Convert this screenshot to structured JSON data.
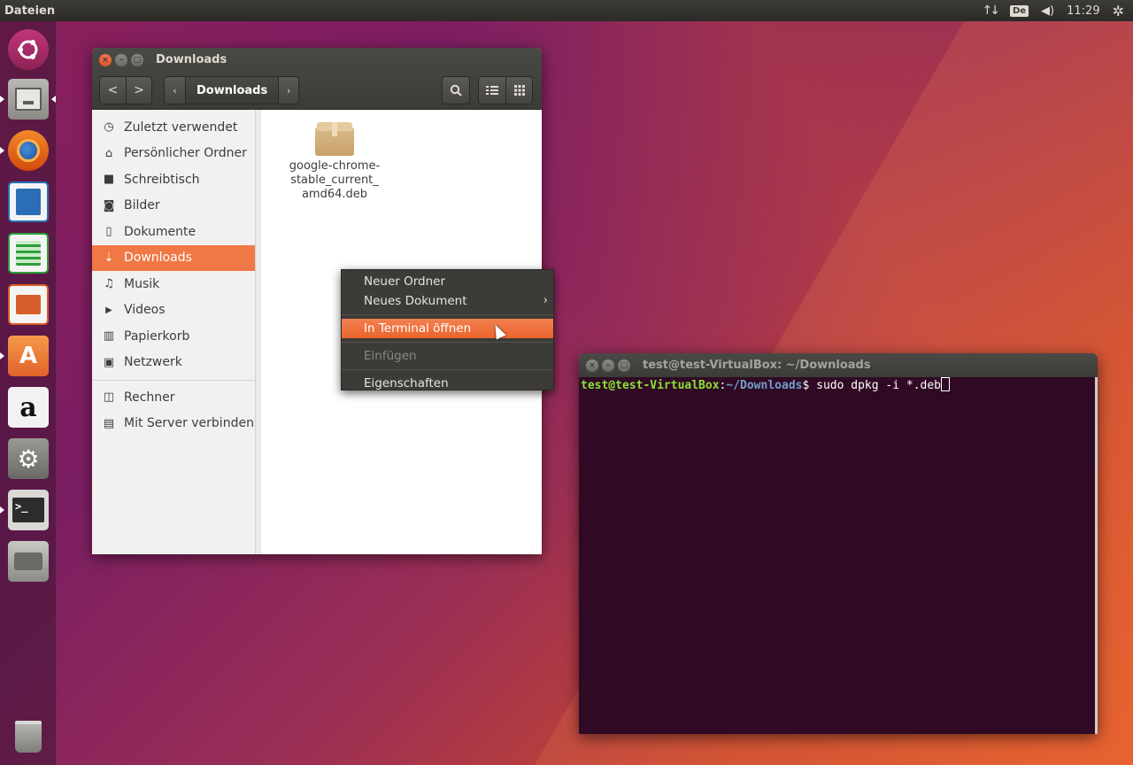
{
  "top_panel": {
    "app_name": "Dateien",
    "keyboard_layout": "De",
    "clock": "11:29"
  },
  "launcher": {
    "items": [
      {
        "name": "dash-home",
        "icon": "ubuntu-logo-icon",
        "color": "#b3306b",
        "active": false
      },
      {
        "name": "files",
        "icon": "files-cabinet-icon",
        "color": "#8c8b86",
        "active": true
      },
      {
        "name": "firefox",
        "icon": "firefox-icon",
        "color": "#e66000",
        "active": true
      },
      {
        "name": "libreoffice-writer",
        "icon": "writer-icon",
        "color": "#2a6fb6",
        "active": false
      },
      {
        "name": "libreoffice-calc",
        "icon": "calc-icon",
        "color": "#2e9e3c",
        "active": false
      },
      {
        "name": "libreoffice-impress",
        "icon": "impress-icon",
        "color": "#d75d2a",
        "active": false
      },
      {
        "name": "ubuntu-software",
        "icon": "software-center-icon",
        "color": "#e8712f",
        "active": true
      },
      {
        "name": "amazon",
        "icon": "amazon-icon",
        "color": "#f2f2f2",
        "active": false
      },
      {
        "name": "system-settings",
        "icon": "settings-tools-icon",
        "color": "#7e7d79",
        "active": false
      },
      {
        "name": "terminal",
        "icon": "terminal-icon",
        "color": "#3c3b37",
        "active": true
      },
      {
        "name": "disk-drive",
        "icon": "drive-icon",
        "color": "#a9a8a4",
        "active": false
      },
      {
        "name": "trash",
        "icon": "trash-icon",
        "color": "#8c8b86",
        "active": false
      }
    ]
  },
  "nautilus": {
    "title": "Downloads",
    "breadcrumb": "Downloads",
    "sidebar": {
      "places": [
        {
          "label": "Zuletzt verwendet",
          "icon": "clock-icon",
          "glyph": "◷"
        },
        {
          "label": "Persönlicher Ordner",
          "icon": "home-icon",
          "glyph": "⌂"
        },
        {
          "label": "Schreibtisch",
          "icon": "folder-icon",
          "glyph": "■"
        },
        {
          "label": "Bilder",
          "icon": "camera-icon",
          "glyph": "◙"
        },
        {
          "label": "Dokumente",
          "icon": "document-icon",
          "glyph": "▯"
        },
        {
          "label": "Downloads",
          "icon": "download-icon",
          "glyph": "⇣",
          "selected": true
        },
        {
          "label": "Musik",
          "icon": "music-icon",
          "glyph": "♫"
        },
        {
          "label": "Videos",
          "icon": "video-icon",
          "glyph": "▶"
        },
        {
          "label": "Papierkorb",
          "icon": "trash-icon",
          "glyph": "▥"
        },
        {
          "label": "Netzwerk",
          "icon": "network-icon",
          "glyph": "▣"
        }
      ],
      "devices": [
        {
          "label": "Rechner",
          "icon": "computer-icon",
          "glyph": "◫"
        },
        {
          "label": "Mit Server verbinden",
          "icon": "server-icon",
          "glyph": "▤"
        }
      ]
    },
    "files": [
      {
        "name": "google-chrome-stable_current_amd64.deb",
        "display_lines": [
          "google-chrome-",
          "stable_current_",
          "amd64.deb"
        ],
        "icon": "package-icon"
      }
    ]
  },
  "context_menu": {
    "items": [
      {
        "label": "Neuer Ordner",
        "state": "normal"
      },
      {
        "label": "Neues Dokument",
        "state": "normal",
        "submenu": true
      },
      {
        "label": "In Terminal öffnen",
        "state": "highlighted"
      },
      {
        "label": "Einfügen",
        "state": "disabled"
      },
      {
        "label": "Eigenschaften",
        "state": "normal"
      }
    ]
  },
  "terminal": {
    "title": "test@test-VirtualBox: ~/Downloads",
    "prompt_user": "test@test-VirtualBox",
    "prompt_sep": ":",
    "prompt_path": "~/Downloads",
    "prompt_symbol": "$ ",
    "command": "sudo dpkg -i *.deb"
  }
}
